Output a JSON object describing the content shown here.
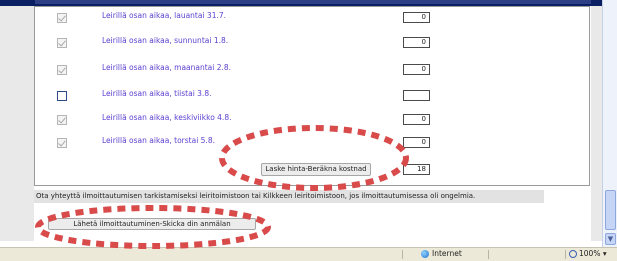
{
  "rows": [
    {
      "label": "Leirillä osan aikaa, lauantai 31.7.",
      "checked": true,
      "value": "0"
    },
    {
      "label": "Leirillä osan aikaa, sunnuntai 1.8.",
      "checked": true,
      "value": "0"
    },
    {
      "label": "Leirillä osan aikaa, maanantai 2.8.",
      "checked": true,
      "value": "0"
    },
    {
      "label": "Leirillä osan aikaa, tiistai 3.8.",
      "checked": false,
      "value": ""
    },
    {
      "label": "Leirillä osan aikaa, keskiviikko 4.8.",
      "checked": true,
      "value": "0"
    },
    {
      "label": "Leirillä osan aikaa, torstai 5.8.",
      "checked": true,
      "value": "0"
    }
  ],
  "calc_button_label": "Laske hinta-Beräkna kostnad",
  "calc_result": "18",
  "info_text": "Ota yhteyttä ilmoittautumisen tarkistamiseksi leiritoimistoon tai Kilkkeen leiritoimistoon, jos ilmoittautumisessa oli ongelmia.",
  "send_button_label": "Lähetä ilmoittautuminen-Skicka din anmälan",
  "status": {
    "zone": "Internet",
    "zoom": "100%"
  },
  "icons": {
    "zone_icon": "globe-icon",
    "zoom_icon": "magnifier-icon"
  },
  "colors": {
    "label_text": "#5b3fd0",
    "annotation": "#d94b4b"
  }
}
